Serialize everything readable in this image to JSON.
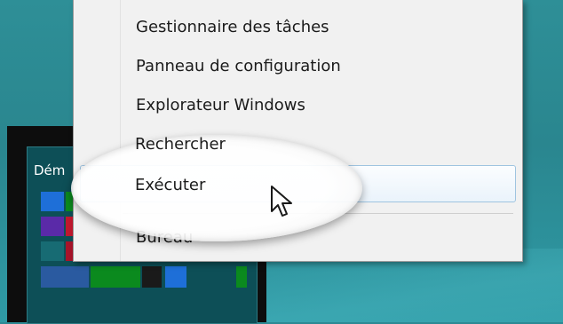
{
  "colors": {
    "desktop": "#2c8a94",
    "menu_background": "#f1f1f1",
    "menu_hover_border": "#9fc4e0",
    "tile_green": "#0b8a1e",
    "tile_blue": "#1e6fd8",
    "tile_purple": "#5a2aa8",
    "tile_red": "#c0182e"
  },
  "start_thumbnail": {
    "label": "Dém"
  },
  "context_menu": {
    "items": [
      {
        "label": "Gestionnaire des tâches"
      },
      {
        "label": "Panneau de configuration"
      },
      {
        "label": "Explorateur Windows"
      },
      {
        "label": "Rechercher"
      },
      {
        "label": "Exécuter",
        "highlighted": true
      },
      {
        "label": "Bureau"
      }
    ]
  },
  "cursor": {
    "icon": "mouse-pointer-icon"
  }
}
